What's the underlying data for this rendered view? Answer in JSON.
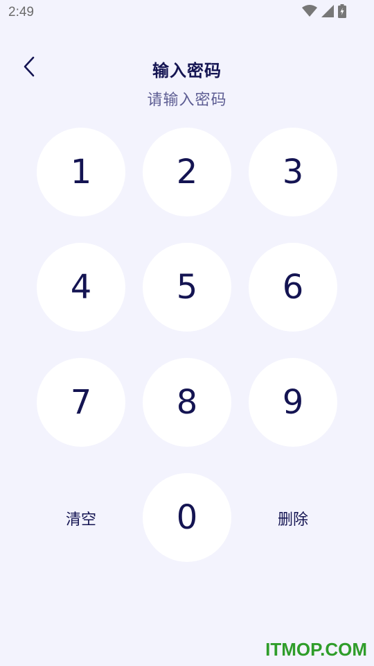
{
  "status_bar": {
    "time": "2:49",
    "icons": [
      "wifi-icon",
      "cellular-signal-icon",
      "battery-charging-icon"
    ]
  },
  "header": {
    "back_icon": "chevron-left-icon",
    "title": "输入密码",
    "subtitle": "请输入密码"
  },
  "keypad": {
    "keys": [
      "1",
      "2",
      "3",
      "4",
      "5",
      "6",
      "7",
      "8",
      "9",
      "0"
    ],
    "clear_label": "清空",
    "delete_label": "删除"
  },
  "watermark": "ITMOP.COM",
  "colors": {
    "background": "#f3f3fd",
    "key_background": "#ffffff",
    "key_text": "#141452",
    "subtitle": "#5d5d93",
    "watermark": "#2f9d2a"
  }
}
